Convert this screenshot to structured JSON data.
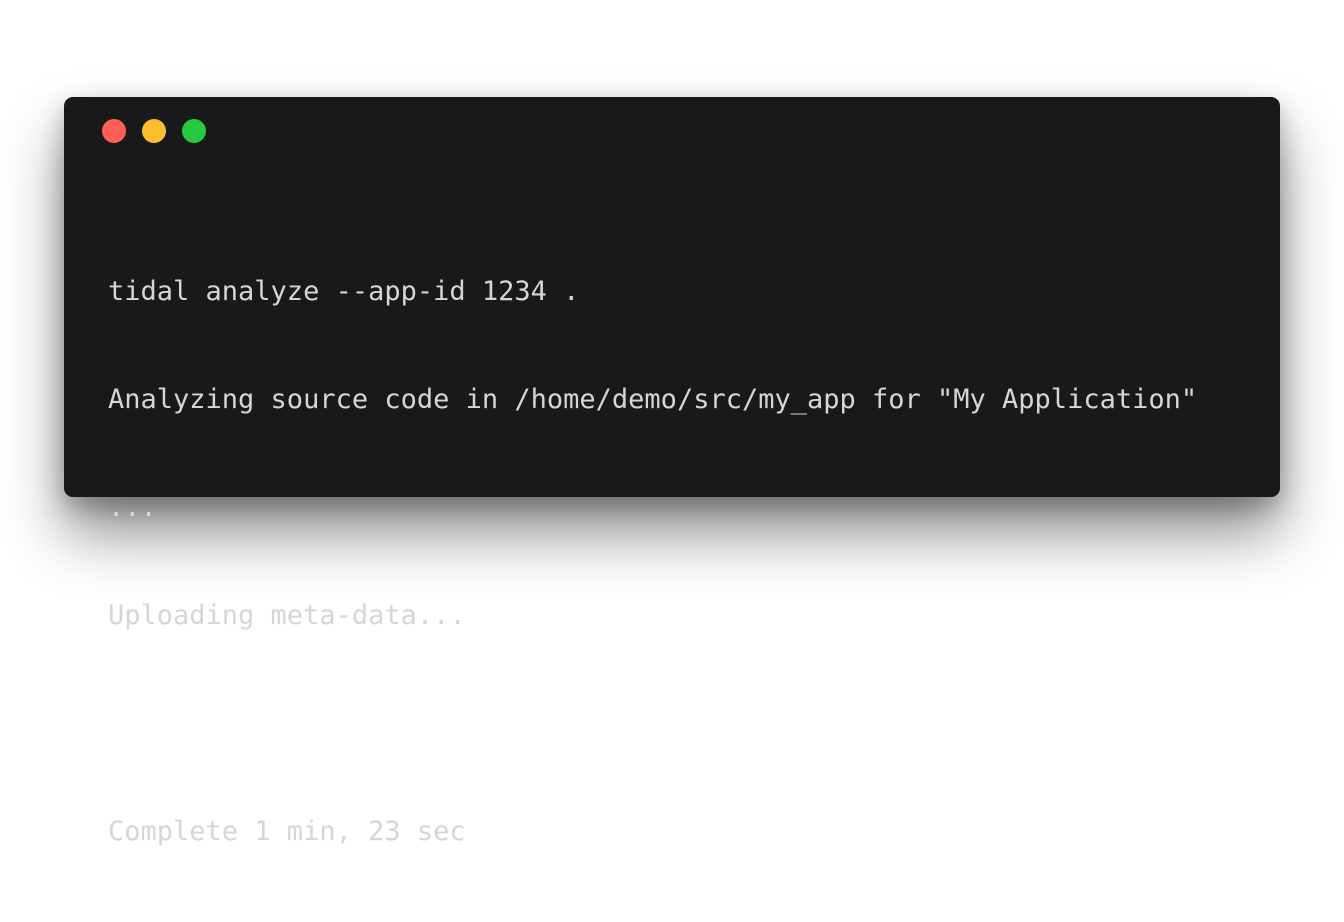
{
  "window": {
    "controls": {
      "close_color": "#ff5f56",
      "minimize_color": "#ffbd2e",
      "maximize_color": "#27c93f"
    },
    "background_color": "#18191b",
    "text_color": "#d6d6d6"
  },
  "terminal": {
    "lines": [
      "tidal analyze --app-id 1234 .",
      "Analyzing source code in /home/demo/src/my_app for \"My Application\"",
      "...",
      "Uploading meta-data...",
      "",
      "Complete 1 min, 23 sec"
    ]
  }
}
